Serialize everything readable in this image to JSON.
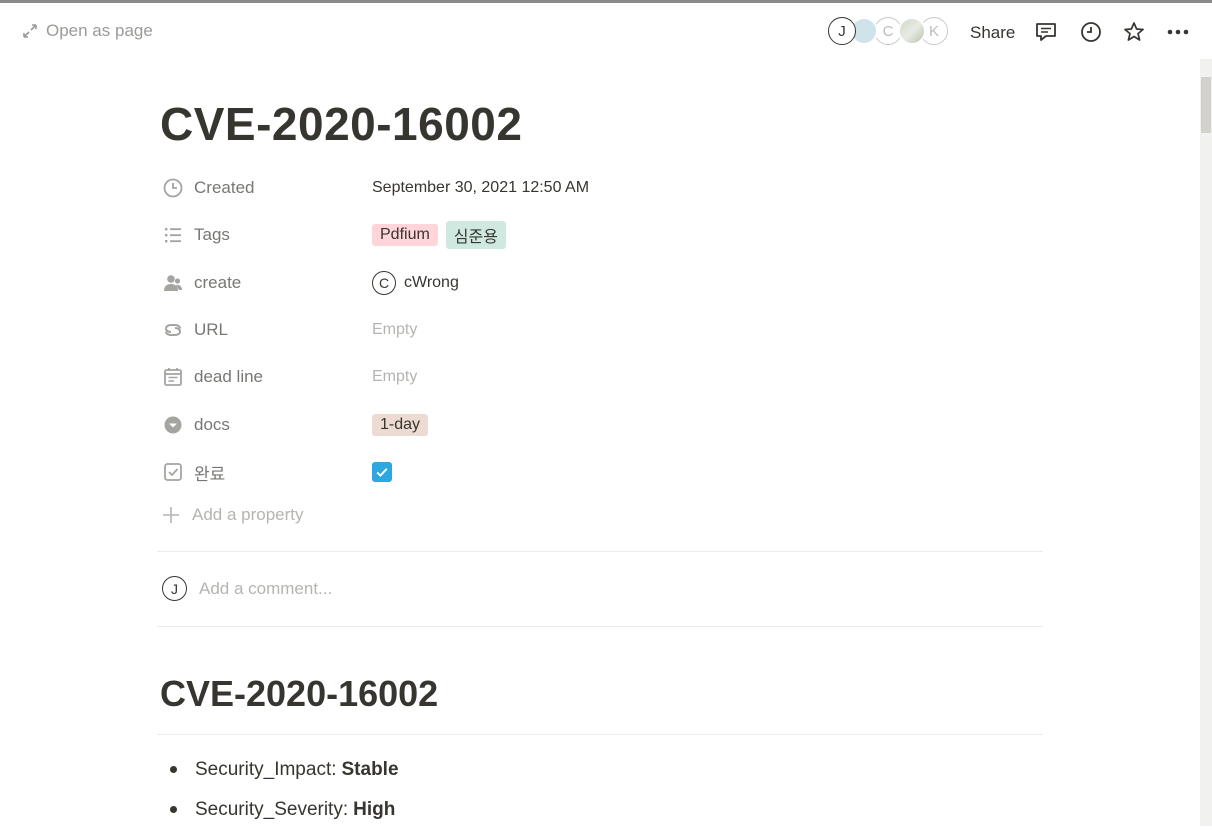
{
  "topbar": {
    "open_as_page": "Open as page",
    "share": "Share",
    "avatars": [
      "J",
      "C",
      "K"
    ]
  },
  "page": {
    "title": "CVE-2020-16002"
  },
  "properties": {
    "created": {
      "label": "Created",
      "value": "September 30, 2021 12:50 AM"
    },
    "tags": {
      "label": "Tags",
      "values": [
        "Pdfium",
        "심준용"
      ]
    },
    "create": {
      "label": "create",
      "person_initial": "C",
      "person_name": "cWrong"
    },
    "url": {
      "label": "URL",
      "value": "Empty"
    },
    "deadline": {
      "label": "dead line",
      "value": "Empty"
    },
    "docs": {
      "label": "docs",
      "value": "1-day"
    },
    "done": {
      "label": "완료",
      "checked": true
    },
    "add_property": "Add a property"
  },
  "comment": {
    "avatar_initial": "J",
    "placeholder": "Add a comment..."
  },
  "content": {
    "heading": "CVE-2020-16002",
    "bullets": [
      {
        "label": "Security_Impact:",
        "value": "Stable"
      },
      {
        "label": "Security_Severity:",
        "value": "High"
      }
    ]
  },
  "colors": {
    "tag_pink": "#ffd5d9",
    "tag_green": "#cfe9e1",
    "tag_brown": "#ebdbd2",
    "checkbox_blue": "#2ea7e0"
  }
}
